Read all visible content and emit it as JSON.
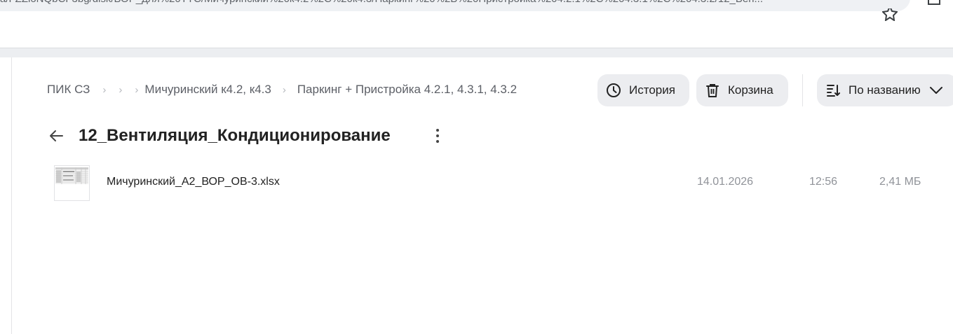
{
  "browser": {
    "url": "a/FZZioNQbCF3bg/disk/ВОР_для%20ТТС/Мичуринский%20к4.2%2C%20к4.3/Паркинг%20%2B%20Пристройка%204.2.1%2C%204.3.1%2C%204.3.2/12_Вен..."
  },
  "breadcrumb": {
    "items": [
      {
        "label": "ПИК СЗ"
      },
      {
        "label": "Мичуринский к4.2, к4.3"
      },
      {
        "label": "Паркинг + Пристройка 4.2.1, 4.3.1, 4.3.2"
      }
    ]
  },
  "toolbar": {
    "history_label": "История",
    "trash_label": "Корзина",
    "sort_label": "По названию"
  },
  "folder": {
    "title": "12_Вентиляция_Кондиционирование"
  },
  "files": [
    {
      "name": "Мичуринский_А2_ВОР_ОВ-3.xlsx",
      "date": "14.01.2026",
      "time": "12:56",
      "size": "2,41 МБ"
    }
  ],
  "icons": {
    "history": "clock-icon",
    "trash": "trash-icon",
    "sort": "sort-icon",
    "back": "arrow-left-icon",
    "more": "more-vertical-icon",
    "star": "star-icon"
  }
}
